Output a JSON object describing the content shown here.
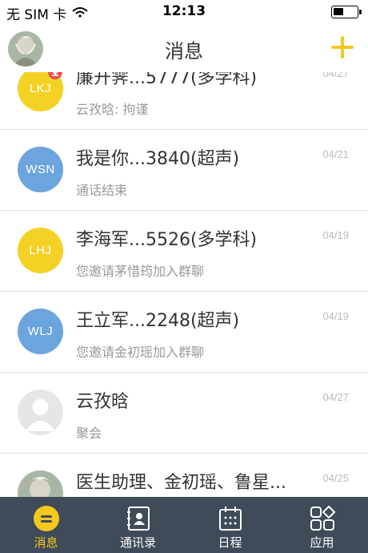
{
  "status_bar": {
    "carrier": "无 SIM 卡",
    "time": "12:13",
    "battery_level": 0.45
  },
  "header": {
    "title": "消息",
    "add_icon": "plus-icon",
    "accent_color": "#f4c81c"
  },
  "conversations": [
    {
      "avatar_text": "LKJ",
      "avatar_color": "yellow",
      "name": "廉开霁...5777(多学科)",
      "date": "04/27",
      "preview": "云孜晗:  拘谨",
      "has_badge": true
    },
    {
      "avatar_text": "WSN",
      "avatar_color": "blue",
      "name": "我是你...3840(超声)",
      "date": "04/21",
      "preview": "通话结束"
    },
    {
      "avatar_text": "LHJ",
      "avatar_color": "yellow",
      "name": "李海军...5526(多学科)",
      "date": "04/19",
      "preview": "您邀请茅惜筠加入群聊"
    },
    {
      "avatar_text": "WLJ",
      "avatar_color": "blue",
      "name": "王立军...2248(超声)",
      "date": "04/19",
      "preview": "您邀请金初瑶加入群聊"
    },
    {
      "avatar_text": "",
      "avatar_color": "gray",
      "name": "云孜晗",
      "date": "04/27",
      "preview": "聚会"
    },
    {
      "avatar_text": "",
      "avatar_color": "photo",
      "name": "医生助理、金初瑶、鲁星...",
      "date": "04/25",
      "preview": ""
    }
  ],
  "tabs": [
    {
      "label": "消息",
      "icon": "message-icon",
      "active": true
    },
    {
      "label": "通讯录",
      "icon": "contacts-icon",
      "active": false
    },
    {
      "label": "日程",
      "icon": "calendar-icon",
      "active": false
    },
    {
      "label": "应用",
      "icon": "apps-icon",
      "active": false
    }
  ]
}
